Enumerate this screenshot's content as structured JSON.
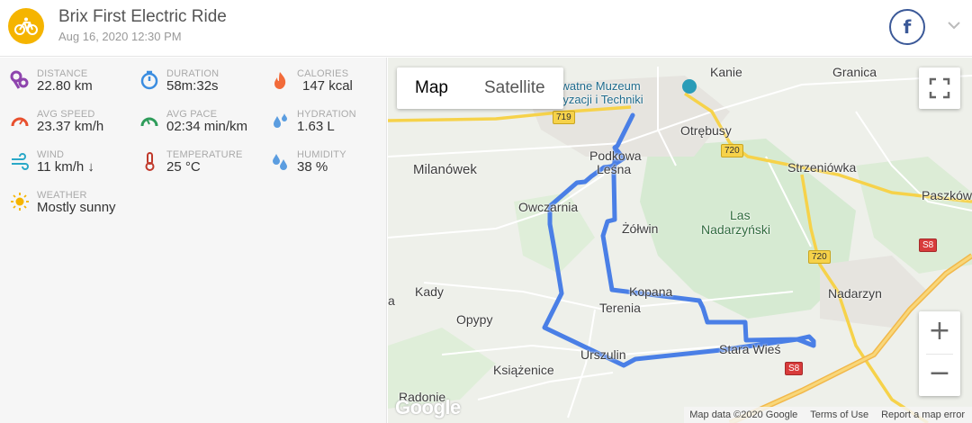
{
  "header": {
    "title": "Brix First Electric Ride",
    "date": "Aug 16, 2020 12:30 PM",
    "share_icon": "facebook-icon",
    "expand_icon": "chevron-down-icon"
  },
  "stats": {
    "distance": {
      "label": "DISTANCE",
      "value": "22.80 km",
      "icon": "route-icon",
      "color": "#8e44ad"
    },
    "duration": {
      "label": "DURATION",
      "value": "58m:32s",
      "icon": "stopwatch-icon",
      "color": "#3b8de0"
    },
    "calories": {
      "label": "CALORIES",
      "value": "147  kcal",
      "icon": "flame-icon",
      "color": "#f26b3a"
    },
    "avg_speed": {
      "label": "AVG SPEED",
      "value": "23.37 km/h",
      "icon": "speedometer-icon",
      "color": "#e8502e"
    },
    "avg_pace": {
      "label": "AVG PACE",
      "value": "02:34 min/km",
      "icon": "pace-gauge-icon",
      "color": "#2e9c5a"
    },
    "hydration": {
      "label": "HYDRATION",
      "value": "1.63 L",
      "icon": "water-drops-icon",
      "color": "#5b9de0"
    },
    "wind": {
      "label": "WIND",
      "value": "11 km/h ↓",
      "icon": "wind-icon",
      "color": "#2aa8c8"
    },
    "temperature": {
      "label": "TEMPERATURE",
      "value": "25 °C",
      "icon": "thermometer-icon",
      "color": "#c0392b"
    },
    "humidity": {
      "label": "HUMIDITY",
      "value": "38 %",
      "icon": "humidity-icon",
      "color": "#5b9de0"
    },
    "weather": {
      "label": "WEATHER",
      "value": "Mostly sunny",
      "icon": "sun-icon",
      "color": "#f5b400"
    }
  },
  "map": {
    "map_type_options": [
      "Map",
      "Satellite"
    ],
    "selected_map_type": "Map",
    "zoom_in": "+",
    "zoom_out": "−",
    "labels": {
      "kanie": "Kanie",
      "granica": "Granica",
      "muzeum1": "ywatne Muzeum",
      "muzeum2": "ryzacji i Techniki",
      "otrebusy": "Otrębusy",
      "milanowek": "Milanówek",
      "podkowa1": "Podkowa",
      "podkowa2": "Leśna",
      "strzeniowka": "Strzeniówka",
      "paszkow": "Paszków",
      "owczarnia": "Owczarnia",
      "zolwin": "Żółwin",
      "las1": "Las",
      "las2": "Nadarzyński",
      "kady": "Kady",
      "a_edge": "a",
      "kopana": "Kopana",
      "terenia": "Terenia",
      "nadarzyn": "Nadarzyn",
      "opypy": "Opypy",
      "urszulin": "Urszulin",
      "stara_wies": "Stara Wieś",
      "ksiazenice": "Książenice",
      "radonie": "Radonie"
    },
    "road_shields": {
      "r719": "719",
      "r720a": "720",
      "r720b": "720",
      "s8a": "S8",
      "s8b": "S8"
    },
    "footer": {
      "map_data": "Map data ©2020 Google",
      "terms": "Terms of Use",
      "report": "Report a map error"
    },
    "google_logo": "Google",
    "route_color": "#4a7fe6"
  }
}
